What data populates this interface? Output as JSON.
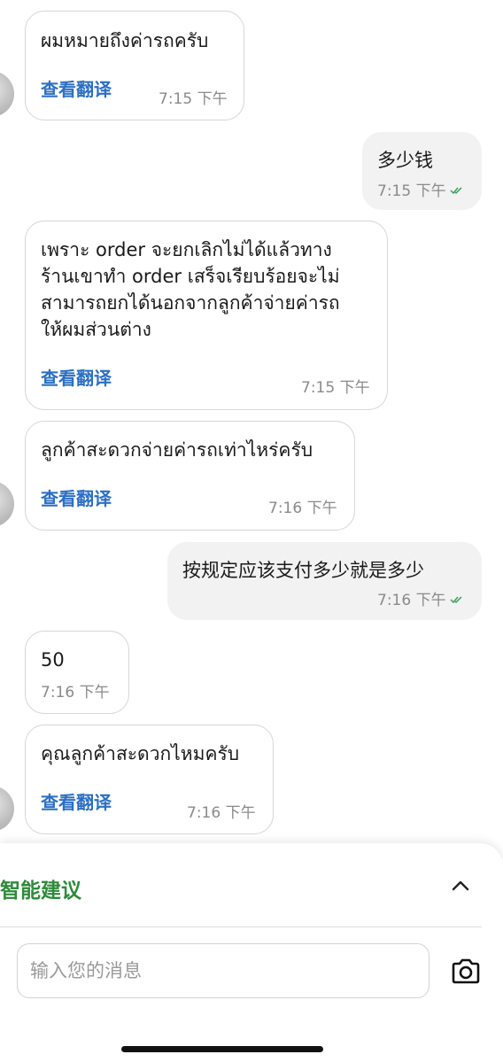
{
  "messages": [
    {
      "direction": "in",
      "text": "ผมหมายถึงค่ารถครับ",
      "translate": "查看翻译",
      "time": "7:15 下午"
    },
    {
      "direction": "out",
      "text": "多少钱",
      "time": "7:15 下午"
    },
    {
      "direction": "in",
      "text": "เพราะ order จะยกเลิกไม่ได้แล้วทาง\nร้านเขาทำ order เสร็จเรียบร้อยจะไม่\nสามารถยกได้นอกจากลูกค้าจ่ายค่ารถ\nให้ผมส่วนต่าง",
      "translate": "查看翻译",
      "time": "7:15 下午"
    },
    {
      "direction": "in",
      "text": "ลูกค้าสะดวกจ่ายค่ารถเท่าไหร่ครับ",
      "translate": "查看翻译",
      "time": "7:16 下午"
    },
    {
      "direction": "out",
      "text": "按规定应该支付多少就是多少",
      "time": "7:16 下午"
    },
    {
      "direction": "in",
      "text": "50",
      "time": "7:16 下午"
    },
    {
      "direction": "in",
      "text": "คุณลูกค้าสะดวกไหมครับ",
      "translate": "查看翻译",
      "time": "7:16 下午"
    }
  ],
  "suggestions": {
    "title": "智能建议"
  },
  "composer": {
    "placeholder": "输入您的消息",
    "value": ""
  },
  "colors": {
    "link": "#2b6fc4",
    "suggest_title": "#2f8a3b",
    "read_check": "#3aa05a",
    "outgoing_bubble": "#f2f2f2"
  }
}
